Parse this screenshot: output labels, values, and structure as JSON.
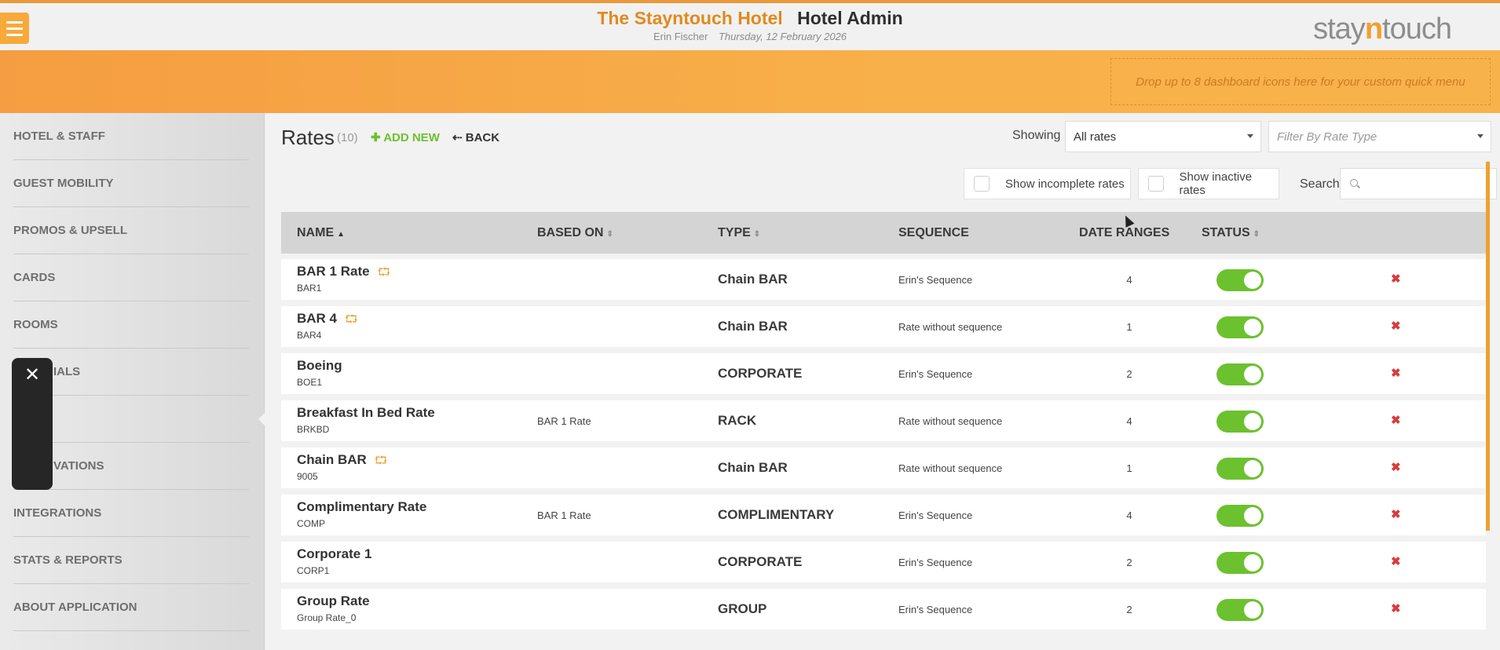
{
  "header": {
    "hotel_name": "The Stayntouch Hotel",
    "app_title": "Hotel Admin",
    "user_name": "Erin Fischer",
    "date": "Thursday, 12 February 2026",
    "brand_left": "stay",
    "brand_n": "n",
    "brand_right": "touch",
    "quick_menu_hint": "Drop up to 8 dashboard icons here for your custom quick menu"
  },
  "colors": {
    "accent": "#f59d42",
    "toggle_on": "#6cc12f",
    "add_new": "#6cc12f",
    "delete": "#d93b3b"
  },
  "sidebar": {
    "items": [
      {
        "label": "HOTEL & STAFF"
      },
      {
        "label": "GUEST MOBILITY"
      },
      {
        "label": "PROMOS & UPSELL"
      },
      {
        "label": "CARDS"
      },
      {
        "label": "ROOMS"
      },
      {
        "label": "IALS"
      },
      {
        "label": ""
      },
      {
        "label": "VATIONS"
      },
      {
        "label": "INTEGRATIONS"
      },
      {
        "label": "STATS & REPORTS"
      },
      {
        "label": "ABOUT APPLICATION"
      }
    ],
    "floating_close": "✕"
  },
  "main": {
    "title": "Rates",
    "count": "(10)",
    "add_new": "ADD NEW",
    "back": "BACK",
    "showing_label": "Showing",
    "showing_value": "All rates",
    "filter_placeholder": "Filter By Rate Type",
    "incomplete_label": "Show incomplete rates",
    "inactive_label": "Show inactive rates",
    "search_label": "Search",
    "search_value": ""
  },
  "table": {
    "columns": [
      "NAME",
      "BASED ON",
      "TYPE",
      "SEQUENCE",
      "DATE RANGES",
      "STATUS"
    ],
    "rows": [
      {
        "name": "BAR 1 Rate",
        "code": "BAR1",
        "chain": true,
        "based_on": "",
        "type": "Chain BAR",
        "sequence": "Erin's Sequence",
        "date_ranges": "4",
        "active": true
      },
      {
        "name": "BAR 4",
        "code": "BAR4",
        "chain": true,
        "based_on": "",
        "type": "Chain BAR",
        "sequence": "Rate without sequence",
        "date_ranges": "1",
        "active": true
      },
      {
        "name": "Boeing",
        "code": "BOE1",
        "chain": false,
        "based_on": "",
        "type": "CORPORATE",
        "sequence": "Erin's Sequence",
        "date_ranges": "2",
        "active": true
      },
      {
        "name": "Breakfast In Bed Rate",
        "code": "BRKBD",
        "chain": false,
        "based_on": "BAR 1 Rate",
        "type": "RACK",
        "sequence": "Rate without sequence",
        "date_ranges": "4",
        "active": true
      },
      {
        "name": "Chain BAR",
        "code": "9005",
        "chain": true,
        "based_on": "",
        "type": "Chain BAR",
        "sequence": "Rate without sequence",
        "date_ranges": "1",
        "active": true
      },
      {
        "name": "Complimentary Rate",
        "code": "COMP",
        "chain": false,
        "based_on": "BAR 1 Rate",
        "type": "COMPLIMENTARY",
        "sequence": "Erin's Sequence",
        "date_ranges": "4",
        "active": true
      },
      {
        "name": "Corporate 1",
        "code": "CORP1",
        "chain": false,
        "based_on": "",
        "type": "CORPORATE",
        "sequence": "Erin's Sequence",
        "date_ranges": "2",
        "active": true
      },
      {
        "name": "Group Rate",
        "code": "Group Rate_0",
        "chain": false,
        "based_on": "",
        "type": "GROUP",
        "sequence": "Erin's Sequence",
        "date_ranges": "2",
        "active": true
      }
    ]
  }
}
